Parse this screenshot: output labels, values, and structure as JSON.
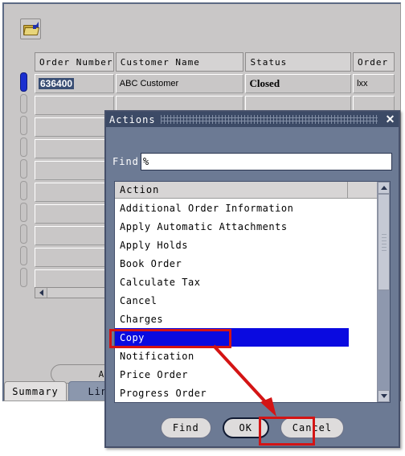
{
  "app": {
    "toolbar": {
      "open_icon": "open-folder-icon"
    },
    "grid": {
      "columns": [
        "Order Number",
        "Customer Name",
        "Status",
        "Order"
      ],
      "rows": [
        {
          "order_number": "636400",
          "customer_name": "ABC Customer",
          "status": "Closed",
          "order": "lxx"
        }
      ],
      "empty_row_count": 9
    },
    "actions_button": "Action:",
    "tabs": [
      {
        "label": "Summary",
        "active": true
      },
      {
        "label": "Lines",
        "active": false
      }
    ],
    "hscroll": {
      "left_arrow": "triangle-left-icon"
    }
  },
  "dialog": {
    "title": "Actions",
    "close_label": "✕",
    "find_label": "Find",
    "find_value": "%",
    "list_header": "Action",
    "items": [
      "Additional Order Information",
      "Apply Automatic Attachments",
      "Apply Holds",
      "Book Order",
      "Calculate Tax",
      "Cancel",
      "Charges",
      "Copy",
      "Notification",
      "Price Order",
      "Progress Order"
    ],
    "selected_item": "Copy",
    "buttons": [
      {
        "label": "Find",
        "focused": false
      },
      {
        "label": "OK",
        "focused": true
      },
      {
        "label": "Cancel",
        "focused": false
      }
    ],
    "scrollbar": {
      "up": "triangle-up-icon",
      "down": "triangle-down-icon"
    }
  },
  "annotations": {
    "highlight_color": "#d41414",
    "selection_color": "#0a0ae0",
    "arrow": "red-arrow-copy-to-ok"
  }
}
